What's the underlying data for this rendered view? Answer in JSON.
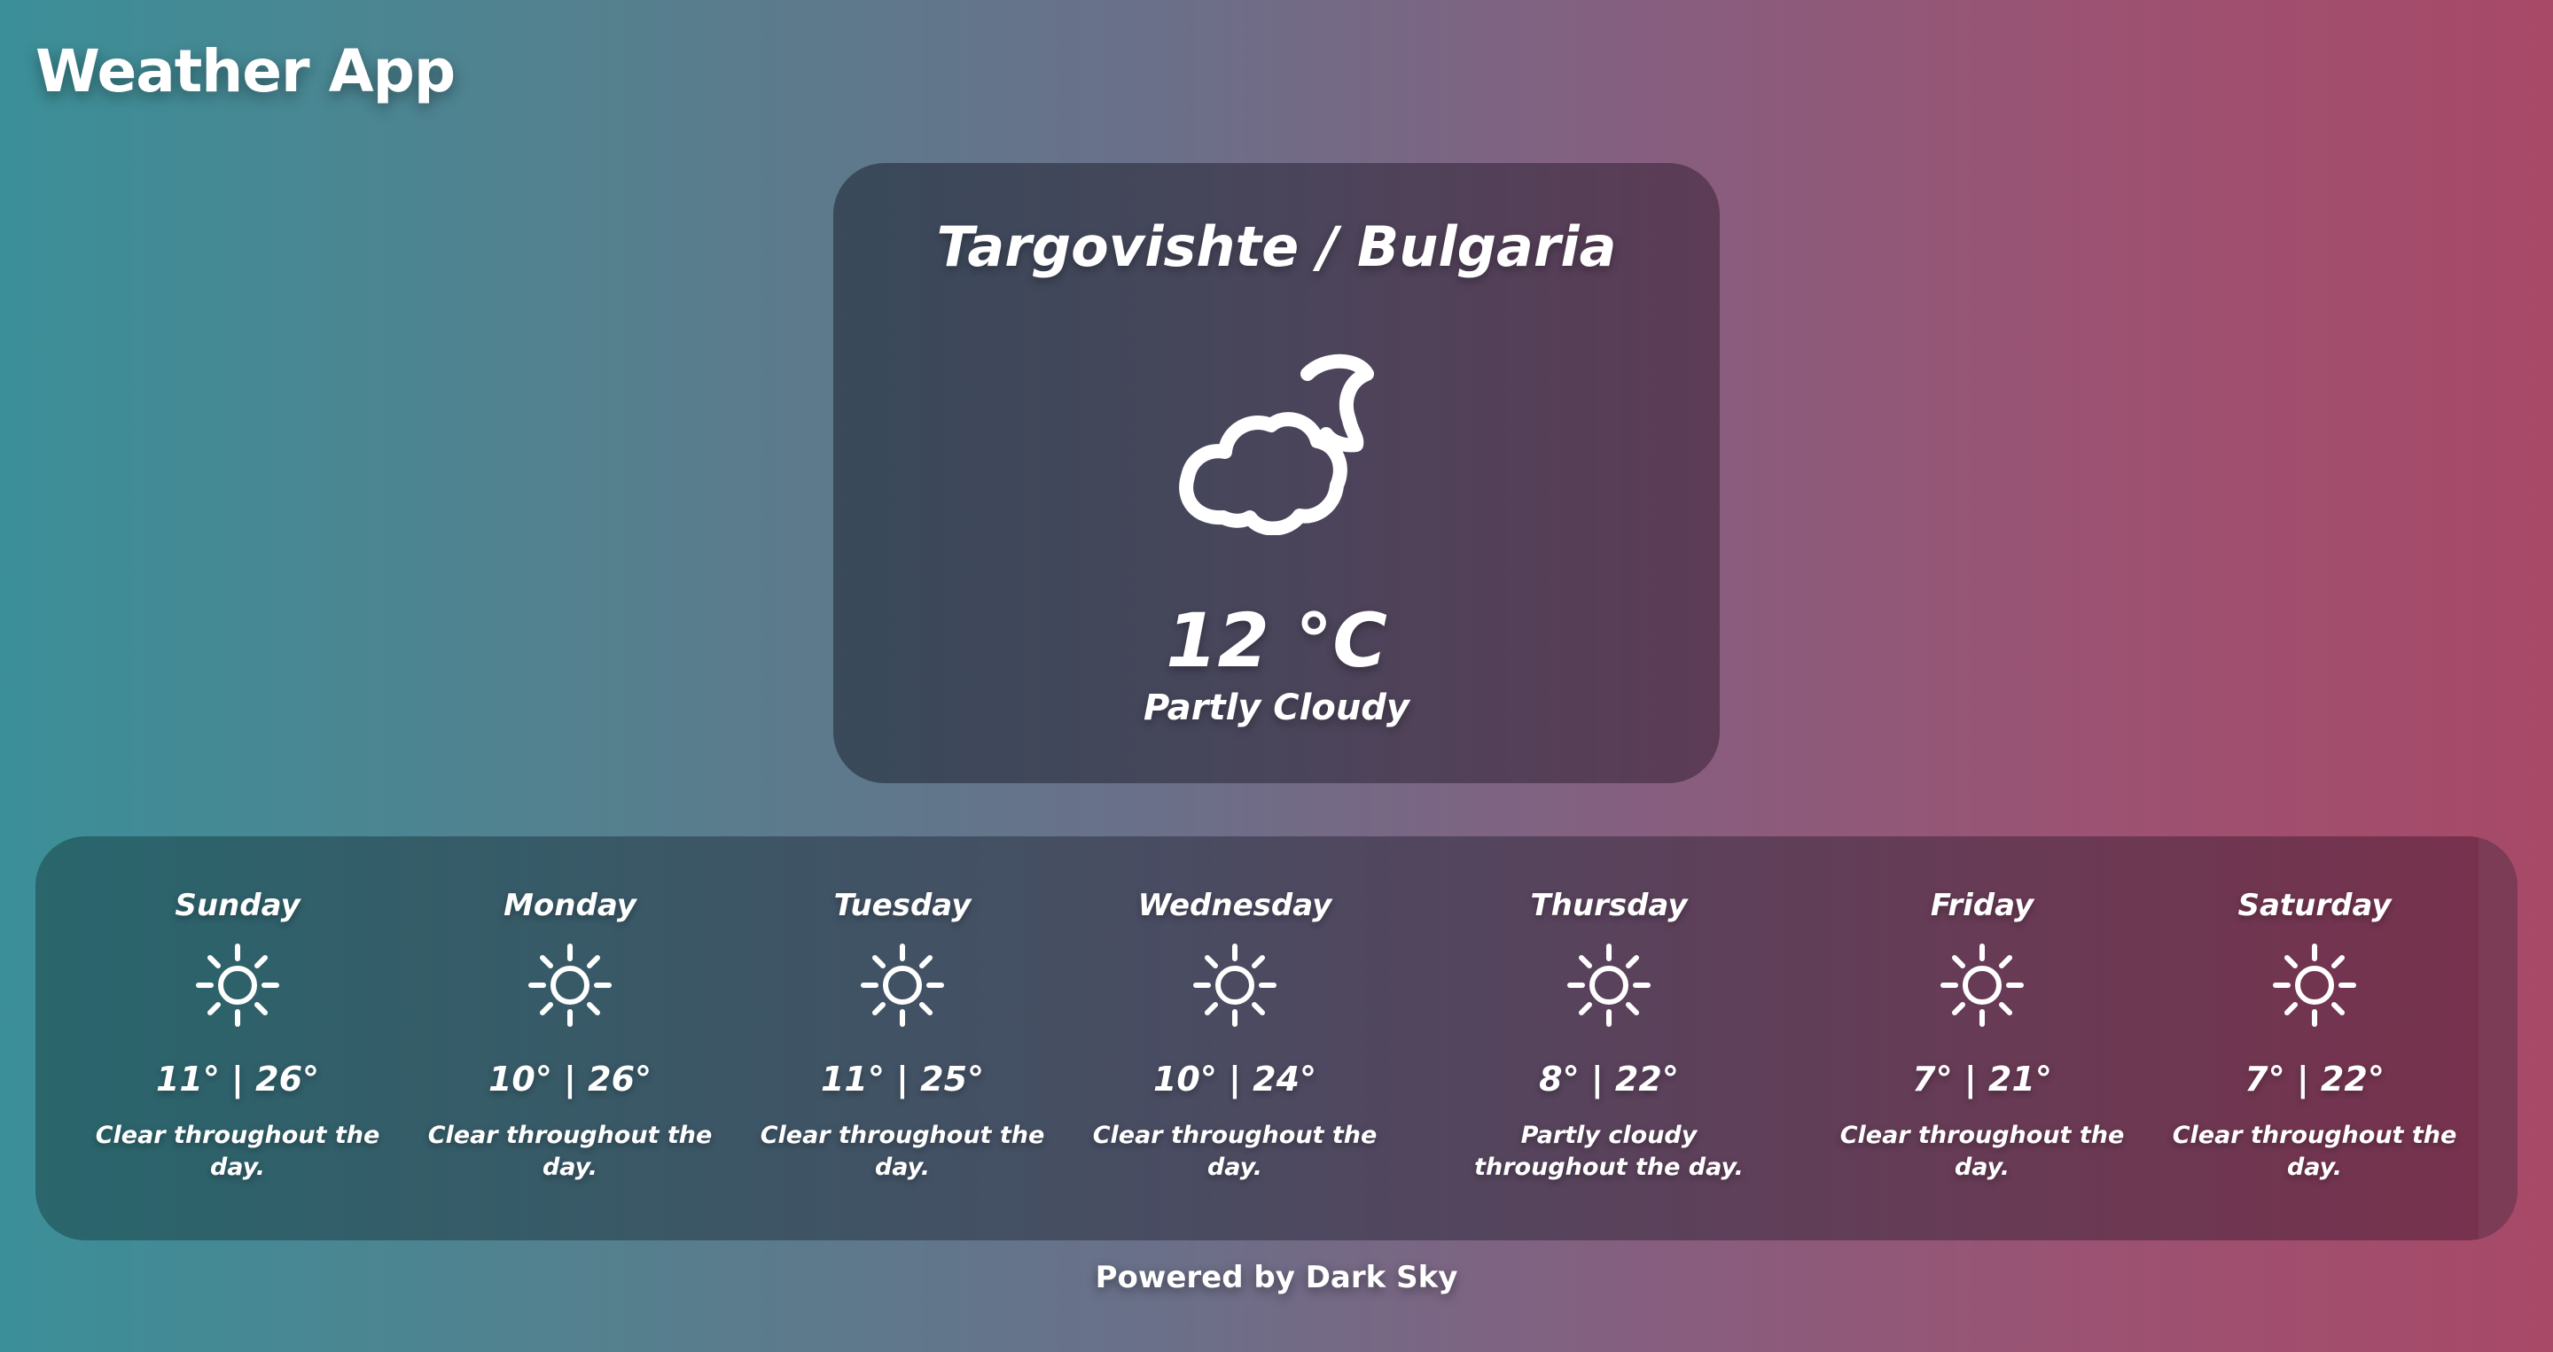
{
  "app": {
    "title": "Weather App"
  },
  "current": {
    "location": "Targovishte / Bulgaria",
    "icon": "partly-cloudy-night-icon",
    "temperature": "12 °C",
    "summary": "Partly Cloudy"
  },
  "forecast": [
    {
      "day": "Sunday",
      "icon": "sun-icon",
      "temps": "11° | 26°",
      "summary": "Clear throughout the day."
    },
    {
      "day": "Monday",
      "icon": "sun-icon",
      "temps": "10° | 26°",
      "summary": "Clear throughout the day."
    },
    {
      "day": "Tuesday",
      "icon": "sun-icon",
      "temps": "11° | 25°",
      "summary": "Clear throughout the day."
    },
    {
      "day": "Wednesday",
      "icon": "sun-icon",
      "temps": "10° | 24°",
      "summary": "Clear throughout the day."
    },
    {
      "day": "Thursday",
      "icon": "sun-icon",
      "temps": "8° | 22°",
      "summary": "Partly cloudy throughout the day."
    },
    {
      "day": "Friday",
      "icon": "sun-icon",
      "temps": "7° | 21°",
      "summary": "Clear throughout the day."
    },
    {
      "day": "Saturday",
      "icon": "sun-icon",
      "temps": "7° | 22°",
      "summary": "Clear throughout the day."
    }
  ],
  "footer": {
    "powered_by": "Powered by Dark Sky"
  },
  "colors": {
    "text": "#ffffff",
    "gradient_left": "#3b8f98",
    "gradient_right": "#a84968"
  }
}
